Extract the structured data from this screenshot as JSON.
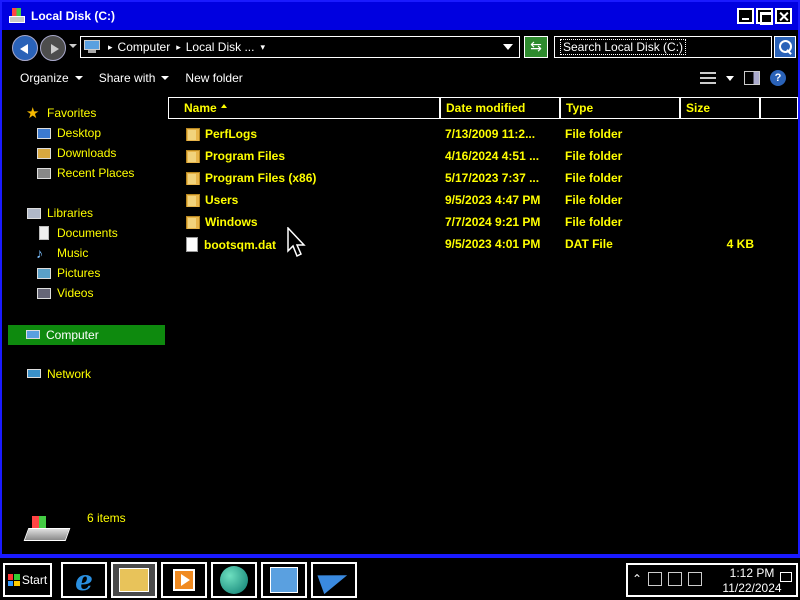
{
  "window": {
    "title": "Local Disk (C:)"
  },
  "address": {
    "crumbs": [
      "Computer",
      "Local Disk ..."
    ],
    "search_placeholder": "Search Local Disk (C:)"
  },
  "toolbar": {
    "organize": "Organize",
    "share_with": "Share with",
    "new_folder": "New folder",
    "icons": [
      "views-icon",
      "preview-pane-icon",
      "help-icon"
    ]
  },
  "nav": {
    "favorites": "Favorites",
    "desktop": "Desktop",
    "downloads": "Downloads",
    "recent_places": "Recent Places",
    "libraries": "Libraries",
    "documents": "Documents",
    "music": "Music",
    "pictures": "Pictures",
    "videos": "Videos",
    "computer": "Computer",
    "network": "Network"
  },
  "columns": {
    "name": "Name",
    "date_modified": "Date modified",
    "type": "Type",
    "size": "Size"
  },
  "files": [
    {
      "name": "PerfLogs",
      "date": "7/13/2009 11:2...",
      "type": "File folder",
      "size": "",
      "icon": "folder-icon"
    },
    {
      "name": "Program Files",
      "date": "4/16/2024 4:51 ...",
      "type": "File folder",
      "size": "",
      "icon": "folder-icon"
    },
    {
      "name": "Program Files (x86)",
      "date": "5/17/2023 7:37 ...",
      "type": "File folder",
      "size": "",
      "icon": "folder-icon"
    },
    {
      "name": "Users",
      "date": "9/5/2023 4:47 PM",
      "type": "File folder",
      "size": "",
      "icon": "folder-icon"
    },
    {
      "name": "Windows",
      "date": "7/7/2024 9:21 PM",
      "type": "File folder",
      "size": "",
      "icon": "folder-icon"
    },
    {
      "name": "bootsqm.dat",
      "date": "9/5/2023 4:01 PM",
      "type": "DAT File",
      "size": "4 KB",
      "icon": "file-icon"
    }
  ],
  "status": {
    "item_count": "6 items"
  },
  "taskbar": {
    "start": "Start",
    "apps": [
      "internet-explorer-icon",
      "file-explorer-icon",
      "media-player-icon",
      "globe-icon",
      "control-panel-icon",
      "plane-icon"
    ],
    "time": "1:12 PM",
    "date": "11/22/2024"
  },
  "colors": {
    "text": "#ffff00",
    "selection": "#0e8a0e",
    "titlebar": "#0000e0"
  }
}
